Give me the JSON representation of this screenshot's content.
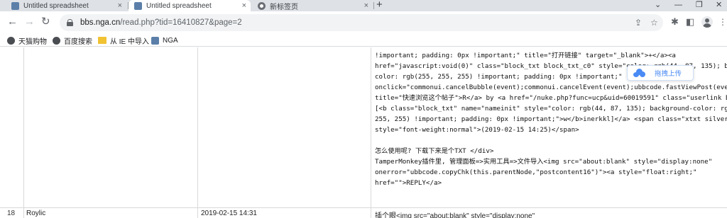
{
  "tabs": [
    {
      "title": "Untitled spreadsheet",
      "close": "×",
      "favicon": "nga-favicon-icon",
      "active": false
    },
    {
      "title": "Untitled spreadsheet",
      "close": "×",
      "favicon": "nga-favicon-icon",
      "active": true
    },
    {
      "title": "新标签页",
      "close": "×",
      "favicon": "chrome-icon",
      "active": false
    }
  ],
  "new_tab_label": "+",
  "window_controls": {
    "collapse": "⌄",
    "minimize": "—",
    "maximize": "❐",
    "close": "✕"
  },
  "toolbar": {
    "back": "←",
    "forward": "→",
    "reload": "↻",
    "url_host": "bbs.nga.cn",
    "url_path": "/read.php?tid=16410827&page=2",
    "share_icon": "⇪",
    "star_icon": "☆",
    "extensions_icon": "✱",
    "sidebar_icon": "◧",
    "menu_icon": "⋮"
  },
  "bookmarks": [
    {
      "label": "天猫购物",
      "icon": "globe-icon"
    },
    {
      "label": "百度搜索",
      "icon": "globe-icon"
    },
    {
      "label": "从 IE 中导入",
      "icon": "folder-icon"
    },
    {
      "label": "NGA",
      "icon": "nga-favicon-icon"
    }
  ],
  "code_lines": [
    "!important; padding: 0px !important;\" title=\"打开链接\" target=\"_blank\">+</a><a",
    "href=\"javascript:void(0)\" class=\"block_txt block_txt_c0\" style=\"color: rgb(44, 87, 135); background-",
    "color: rgb(255, 255, 255) !important; padding: 0px !important;\"",
    "onclick=\"commonui.cancelBubble(event);commonui.cancelEvent(event);ubbcode.fastViewPost(event,164",
    "title=\"快速浏览这个帖子\">R</a> by <a href=\"/nuke.php?func=ucp&uid=60019591\" class=\"userlink b\">",
    "[<b class=\"block_txt\" name=\"nameinit\" style=\"color: rgb(44, 87, 135); background-color: rgb(255,",
    "255, 255) !important; padding: 0px !important;\">w</b>inerkkl]</a> <span class=\"xtxt silver\"",
    "style=\"font-weight:normal\">(2019-02-15 14:25)</span>",
    "",
    "怎么使用呢? 下载下来是个TXT </div>",
    "TamperMonkey插件里, 管理面板=>实用工具=>文件导入<img src=\"about:blank\" style=\"display:none\"",
    "onerror=\"ubbcode.copyChk(this.parentNode,\"postcontent16\")\"><a style=\"float:right;\"",
    "href=\"\">REPLY</a>"
  ],
  "next_row": {
    "number": "18",
    "name": "Roylic",
    "date": "2019-02-15 14:31",
    "text": "插个眼<img src=\"about:blank\" style=\"display:none\""
  },
  "uploader": {
    "label": "拖拽上传",
    "icon": "cloud-icon",
    "accent": "#4a8af4"
  }
}
